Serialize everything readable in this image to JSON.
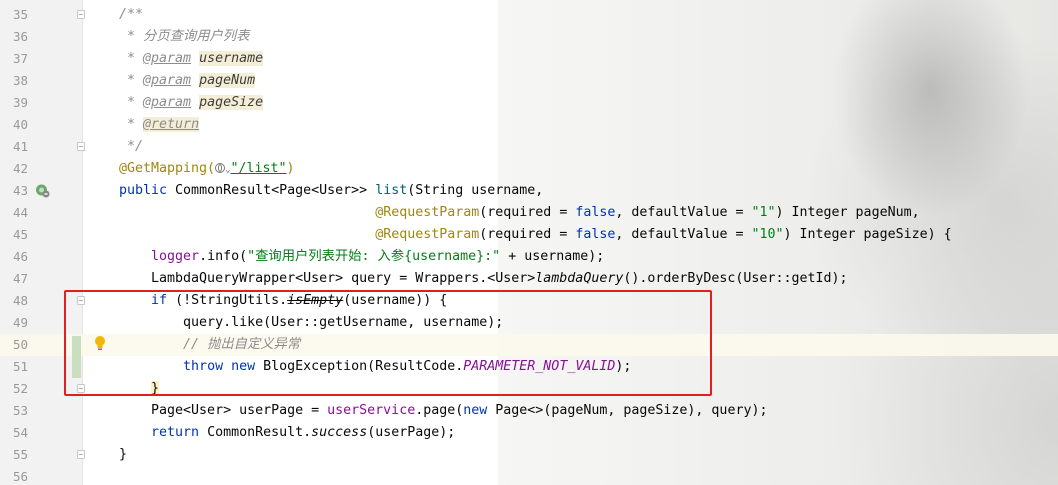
{
  "editor": {
    "lines": [
      {
        "num": "35",
        "parts": [
          [
            "cmt",
            "/**"
          ]
        ]
      },
      {
        "num": "36",
        "parts": [
          [
            "cmt",
            " * 分页查询用户列表"
          ]
        ]
      },
      {
        "num": "37",
        "parts": [
          [
            "cmt",
            " * "
          ],
          [
            "ptag",
            "@param"
          ],
          [
            "cmt",
            " "
          ],
          [
            "pname",
            "username"
          ]
        ]
      },
      {
        "num": "38",
        "parts": [
          [
            "cmt",
            " * "
          ],
          [
            "ptag",
            "@param"
          ],
          [
            "cmt",
            " "
          ],
          [
            "pname",
            "pageNum"
          ]
        ]
      },
      {
        "num": "39",
        "parts": [
          [
            "cmt",
            " * "
          ],
          [
            "ptag",
            "@param"
          ],
          [
            "cmt",
            " "
          ],
          [
            "pname",
            "pageSize"
          ]
        ]
      },
      {
        "num": "40",
        "parts": [
          [
            "cmt",
            " * "
          ],
          [
            "pname-ret",
            "@return"
          ]
        ]
      },
      {
        "num": "41",
        "parts": [
          [
            "cmt",
            " */"
          ]
        ]
      },
      {
        "num": "42",
        "parts": [
          [
            "ann",
            "@GetMapping("
          ],
          [
            "globe",
            ""
          ],
          [
            "chev",
            "⌄"
          ],
          [
            "link",
            "\"/list\""
          ],
          [
            "ann",
            ")"
          ]
        ]
      },
      {
        "num": "43",
        "parts": [
          [
            "kw",
            "public "
          ],
          [
            "",
            "CommonResult<Page<User>> "
          ],
          [
            "mth",
            "list"
          ],
          [
            "",
            "(String username,"
          ]
        ]
      },
      {
        "num": "44",
        "parts": [
          [
            "",
            "                                "
          ],
          [
            "ann",
            "@RequestParam"
          ],
          [
            "",
            "(required = "
          ],
          [
            "kw",
            "false"
          ],
          [
            "",
            ", defaultValue = "
          ],
          [
            "str",
            "\"1\""
          ],
          [
            "",
            ") Integer pageNum,"
          ]
        ]
      },
      {
        "num": "45",
        "parts": [
          [
            "",
            "                                "
          ],
          [
            "ann",
            "@RequestParam"
          ],
          [
            "",
            "(required = "
          ],
          [
            "kw",
            "false"
          ],
          [
            "",
            ", defaultValue = "
          ],
          [
            "str",
            "\"10\""
          ],
          [
            "",
            ") Integer pageSize) {"
          ]
        ]
      },
      {
        "num": "46",
        "parts": [
          [
            "",
            "    "
          ],
          [
            "fld-plain",
            "logger"
          ],
          [
            "",
            ".info("
          ],
          [
            "str",
            "\"查询用户列表开始: 入参{username}:\""
          ],
          [
            "",
            " + username);"
          ]
        ]
      },
      {
        "num": "47",
        "parts": [
          [
            "",
            "    LambdaQueryWrapper<User> query = Wrappers.<User>"
          ],
          [
            "st",
            "lambdaQuery"
          ],
          [
            "",
            "().orderByDesc(User::getId);"
          ]
        ]
      },
      {
        "num": "48",
        "parts": [
          [
            "",
            "    "
          ],
          [
            "kw",
            "if "
          ],
          [
            "",
            "(!StringUtils."
          ],
          [
            "del",
            "isEmpty"
          ],
          [
            "",
            "(username)) {"
          ]
        ]
      },
      {
        "num": "49",
        "parts": [
          [
            "",
            "        query.like(User::getUsername, username);"
          ]
        ]
      },
      {
        "num": "50",
        "parts": [
          [
            "",
            "        "
          ],
          [
            "cmt",
            "// 抛出自定义异常"
          ]
        ]
      },
      {
        "num": "51",
        "parts": [
          [
            "",
            "        "
          ],
          [
            "kw",
            "throw new "
          ],
          [
            "",
            "BlogException(ResultCode."
          ],
          [
            "ifld",
            "PARAMETER_NOT_VALID"
          ],
          [
            "",
            ");"
          ]
        ]
      },
      {
        "num": "52",
        "parts": [
          [
            "",
            "    "
          ],
          [
            "brace",
            "}"
          ]
        ]
      },
      {
        "num": "53",
        "parts": [
          [
            "",
            "    Page<User> userPage = "
          ],
          [
            "fld-plain",
            "userService"
          ],
          [
            "",
            ".page("
          ],
          [
            "kw",
            "new "
          ],
          [
            "",
            "Page<>(pageNum, pageSize), query);"
          ]
        ]
      },
      {
        "num": "54",
        "parts": [
          [
            "",
            "    "
          ],
          [
            "kw",
            "return "
          ],
          [
            "",
            "CommonResult."
          ],
          [
            "st",
            "success"
          ],
          [
            "",
            "(userPage);"
          ]
        ]
      },
      {
        "num": "55",
        "parts": [
          [
            "",
            "}"
          ]
        ]
      },
      {
        "num": "56",
        "parts": []
      }
    ],
    "current_line": "50",
    "fold_lines": [
      "35",
      "41",
      "48",
      "52",
      "55"
    ]
  }
}
